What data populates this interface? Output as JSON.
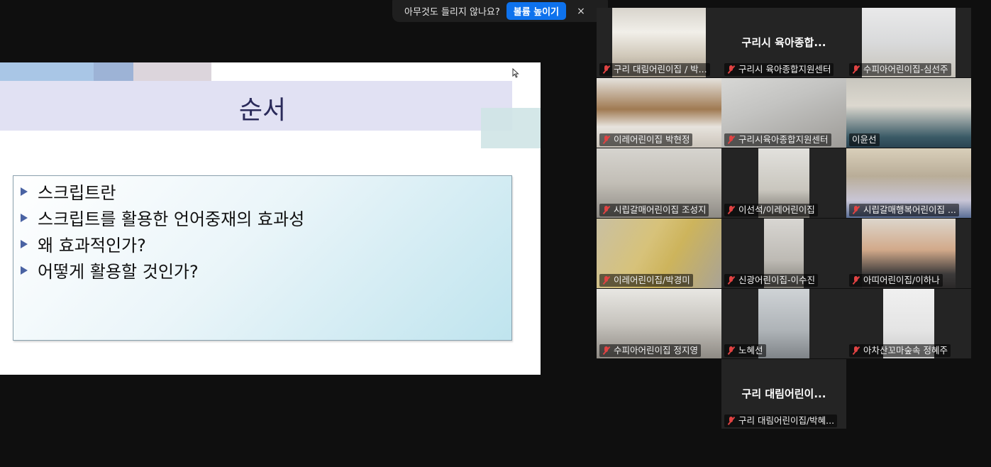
{
  "banner": {
    "message": "아무것도 들리지 않나요?",
    "button_label": "볼륨 높이기",
    "close_label": "×"
  },
  "slide": {
    "title": "순서",
    "bullets": [
      "스크립트란",
      "스크립트를 활용한 언어중재의 효과성",
      "왜 효과적인가?",
      "어떻게 활용할 것인가?"
    ]
  },
  "participants": [
    {
      "name": "구리 대림어린이집 / 박...",
      "big": ""
    },
    {
      "name": "구리시 육아종합지원센터",
      "big": "구리시 육아종합..."
    },
    {
      "name": "수피아어린이집-심선주",
      "big": ""
    },
    {
      "name": "이레어린이집 박현정",
      "big": ""
    },
    {
      "name": "구리시육아종합지원센터",
      "big": ""
    },
    {
      "name": "이윤선",
      "big": ""
    },
    {
      "name": "시립갈매어린이집 조성지",
      "big": ""
    },
    {
      "name": "이선석/이레어린이집",
      "big": ""
    },
    {
      "name": "시립갈매행복어린이집 ...",
      "big": ""
    },
    {
      "name": "이레어린이집/박경미",
      "big": ""
    },
    {
      "name": "신광어린이집-이수진",
      "big": ""
    },
    {
      "name": "아띠어린이집/이하나",
      "big": ""
    },
    {
      "name": "수피아어린이집 정지영",
      "big": ""
    },
    {
      "name": "노혜선",
      "big": ""
    },
    {
      "name": "아차산꼬마숲속 정혜주",
      "big": ""
    },
    {
      "name": "구리 대림어린이집/박혜...",
      "big": "구리 대림어린이..."
    }
  ]
}
